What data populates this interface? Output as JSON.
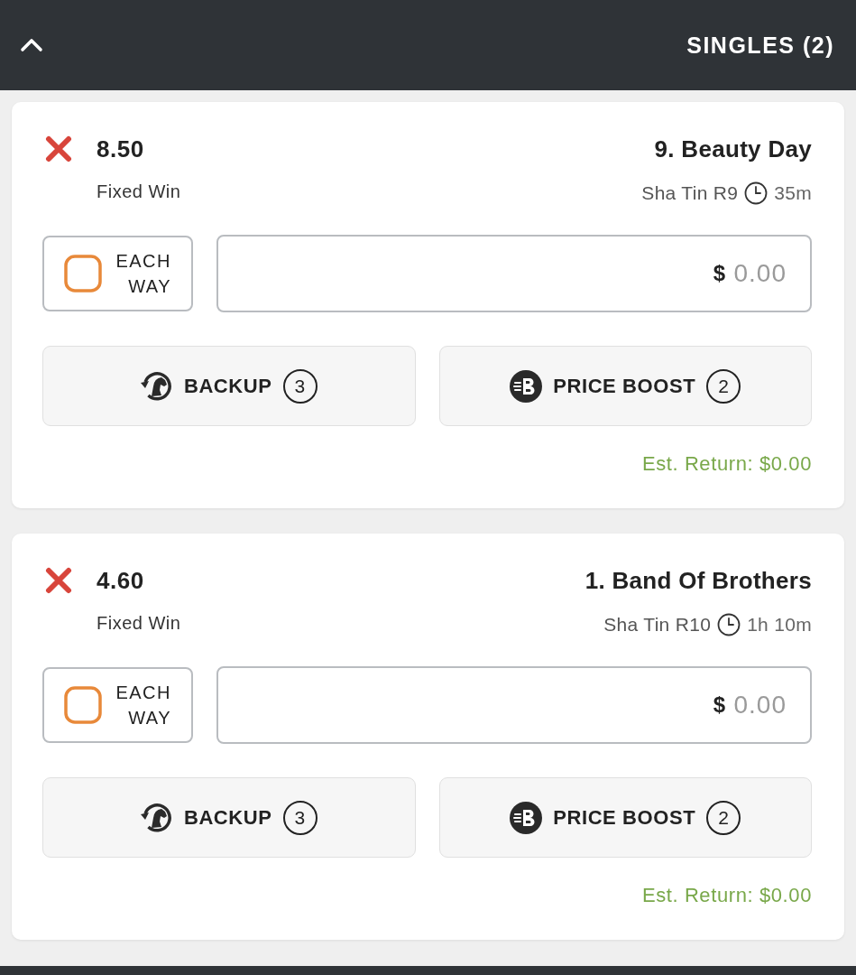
{
  "header": {
    "title": "SINGLES (2)",
    "expanded": true
  },
  "bets": [
    {
      "selection": "9. Beauty Day",
      "odds": "8.50",
      "meeting": "Sha Tin R9",
      "countdown": "35m",
      "bet_type": "Fixed Win",
      "stake": {
        "currency": "$",
        "placeholder": "0.00"
      },
      "each_way": {
        "label": "EACH WAY",
        "checked": false
      },
      "actions": [
        {
          "kind": "backup",
          "label": "BACKUP",
          "count": "3"
        },
        {
          "kind": "boost",
          "label": "PRICE BOOST",
          "count": "2"
        }
      ],
      "est_return": "Est. Return: $0.00"
    },
    {
      "selection": "1. Band Of Brothers",
      "odds": "4.60",
      "meeting": "Sha Tin R10",
      "countdown": "1h 10m",
      "bet_type": "Fixed Win",
      "stake": {
        "currency": "$",
        "placeholder": "0.00"
      },
      "each_way": {
        "label": "EACH WAY",
        "checked": false
      },
      "actions": [
        {
          "kind": "backup",
          "label": "BACKUP",
          "count": "3"
        },
        {
          "kind": "boost",
          "label": "PRICE BOOST",
          "count": "2"
        }
      ],
      "est_return": "Est. Return: $0.00"
    }
  ]
}
